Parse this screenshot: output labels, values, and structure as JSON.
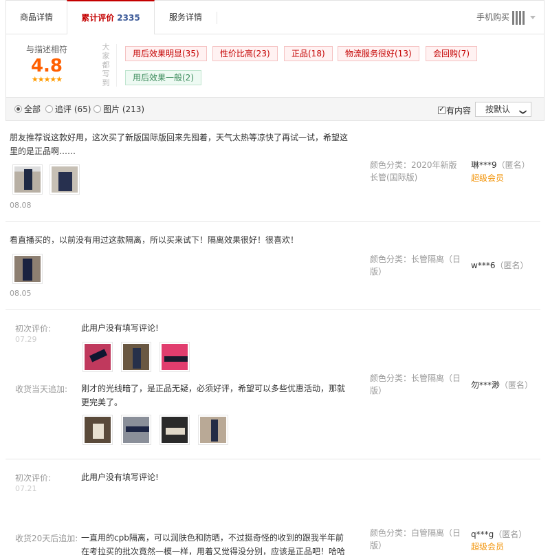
{
  "tabs": {
    "details": "商品详情",
    "reviews": "累计评价",
    "reviews_count": "2335",
    "service": "服务详情",
    "mobile_buy": "手机购买"
  },
  "rating": {
    "label": "与描述相符",
    "score": "4.8",
    "stars": "★★★★★",
    "vertical_label": "大家都写到",
    "tags": [
      {
        "text": "用后效果明显(35)",
        "type": "positive"
      },
      {
        "text": "性价比高(23)",
        "type": "positive"
      },
      {
        "text": "正品(18)",
        "type": "positive"
      },
      {
        "text": "物流服务很好(13)",
        "type": "positive"
      },
      {
        "text": "会回购(7)",
        "type": "positive"
      },
      {
        "text": "用后效果一般(2)",
        "type": "negative"
      }
    ]
  },
  "filter": {
    "all": "全部",
    "append": "追评 (65)",
    "pictures": "图片 (213)",
    "has_content": "有内容",
    "sort": "按默认",
    "sort_caret": "❯"
  },
  "reviews": [
    {
      "text": "朋友推荐说这款好用，这次买了新版国际版回来先囤着，天气太热等凉快了再试一试，希望这里的是正品啊……",
      "date": "08.08",
      "sku": "颜色分类：2020年新版长管(国际版)",
      "user": "琳***9",
      "anon": "（匿名）",
      "vip": "超级会员"
    },
    {
      "text": "看直播买的，以前没有用过这款隔离，所以买来试下！隔离效果很好！很喜欢！",
      "date": "08.05",
      "sku": "颜色分类：长管隔离（日版）",
      "user": "w***6",
      "anon": "（匿名）"
    },
    {
      "first_label": "初次评价:",
      "first_date": "07.29",
      "first_text": "此用户没有填写评论!",
      "append_label": "收货当天追加:",
      "append_text": "刚才的光线暗了，是正品无疑，必须好评，希望可以多些优惠活动，那就更完美了。",
      "sku": "颜色分类：长管隔离（日版）",
      "user": "勿***渺",
      "anon": "（匿名）"
    },
    {
      "first_label": "初次评价:",
      "first_date": "07.21",
      "first_text": "此用户没有填写评论!",
      "append_label": "收货20天后追加:",
      "append_text": "一直用的cpb隔离，可以润肤色和防晒，不过挺奇怪的收到的跟我半年前在考拉买的批次竟然一模一样，用着又觉得没分别，应该是正品吧！哈哈",
      "sku": "颜色分类：白管隔离（日版）",
      "user": "q***g",
      "anon": "（匿名）",
      "vip": "超级会员"
    }
  ]
}
